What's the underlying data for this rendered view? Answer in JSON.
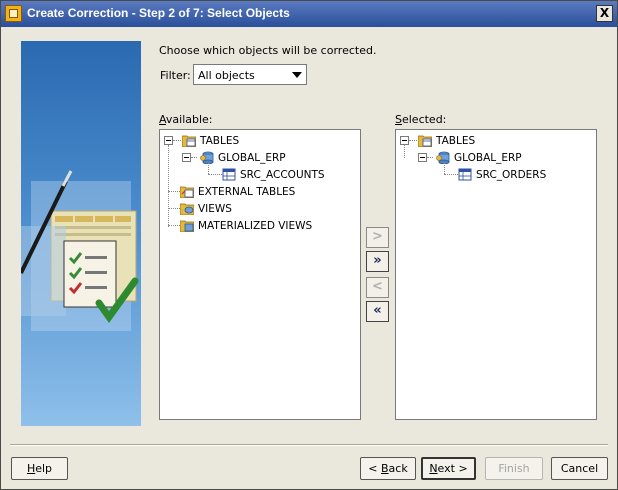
{
  "window": {
    "title": "Create Correction - Step 2 of 7: Select Objects",
    "close_label": "X"
  },
  "instructions": "Choose which objects will be corrected.",
  "filter": {
    "label": "Filter:",
    "selected": "All objects"
  },
  "available": {
    "label": "Available:",
    "nodes": {
      "tables": "TABLES",
      "global_erp": "GLOBAL_ERP",
      "src_accounts": "SRC_ACCOUNTS",
      "external_tables": "EXTERNAL TABLES",
      "views": "VIEWS",
      "materialized_views": "MATERIALIZED VIEWS"
    }
  },
  "selected": {
    "label": "Selected:",
    "nodes": {
      "tables": "TABLES",
      "global_erp": "GLOBAL_ERP",
      "src_orders": "SRC_ORDERS"
    }
  },
  "shuttle": {
    "move_one": ">",
    "move_all": "»",
    "remove_one": "<",
    "remove_all": "«"
  },
  "buttons": {
    "help": "Help",
    "back": "< Back",
    "next": "Next >",
    "finish": "Finish",
    "cancel": "Cancel"
  }
}
